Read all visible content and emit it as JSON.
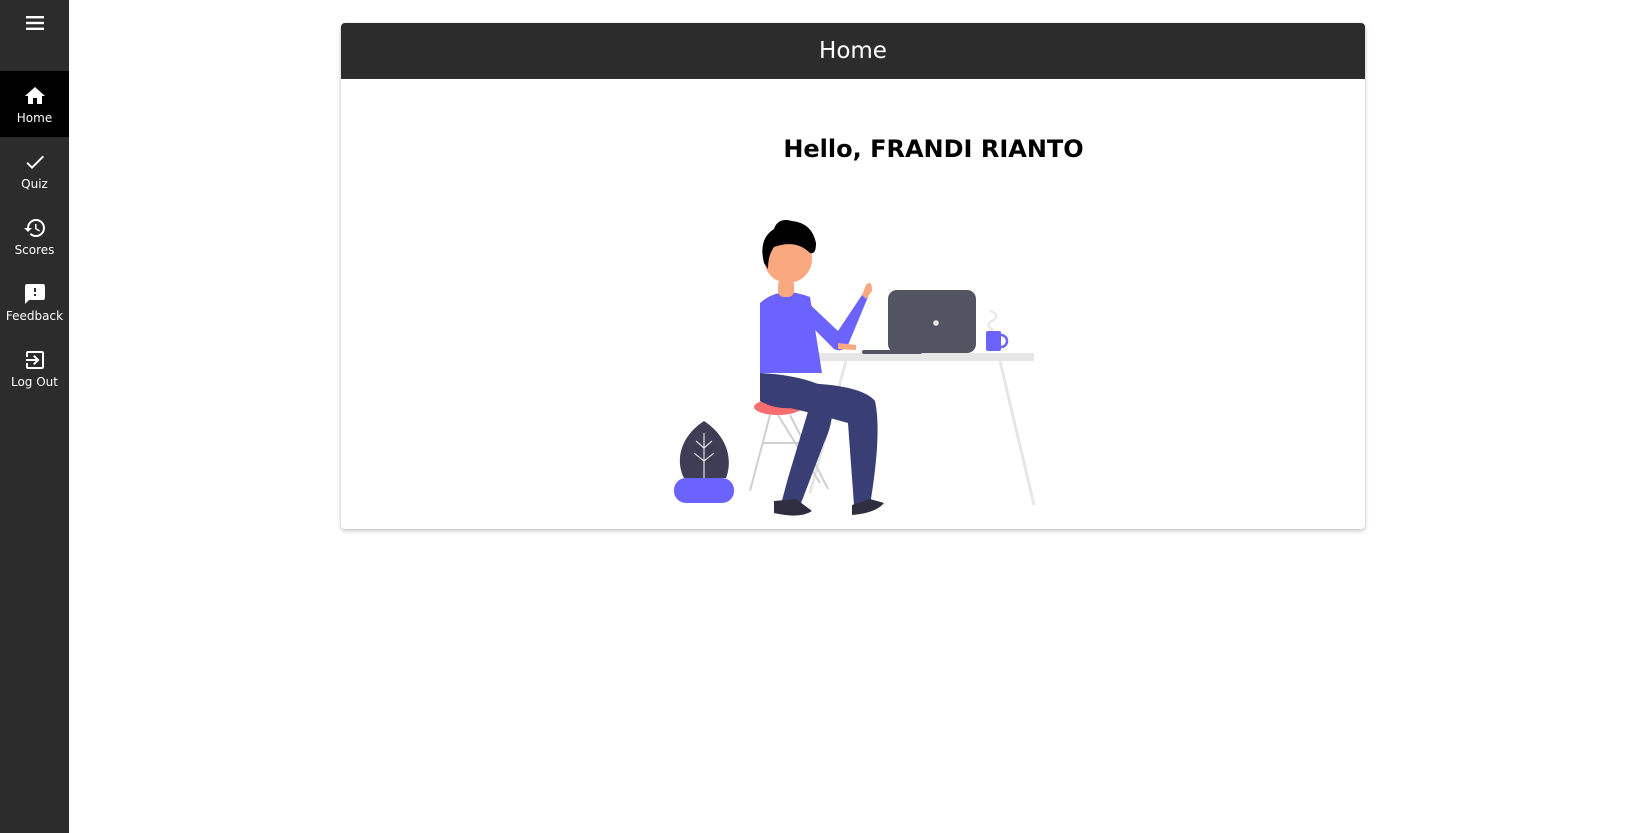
{
  "sidebar": {
    "menu_icon": "hamburger-menu-icon",
    "items": [
      {
        "label": "Home",
        "icon": "home-icon",
        "active": true
      },
      {
        "label": "Quiz",
        "icon": "check-icon",
        "active": false
      },
      {
        "label": "Scores",
        "icon": "history-icon",
        "active": false
      },
      {
        "label": "Feedback",
        "icon": "feedback-icon",
        "active": false
      },
      {
        "label": "Log Out",
        "icon": "logout-icon",
        "active": false
      }
    ]
  },
  "card": {
    "title": "Home",
    "greeting": "Hello, FRANDI RIANTO",
    "illustration": "person-working-at-laptop-illustration"
  },
  "colors": {
    "sidebar_bg": "#2c2c2c",
    "active_bg": "#000000",
    "header_bg": "#2c2c2c",
    "accent": "#6c63ff"
  }
}
